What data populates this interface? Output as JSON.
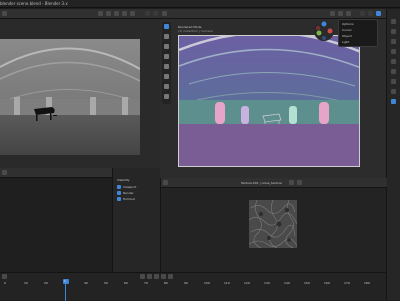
{
  "app": {
    "window_title": "blender scene.blend - Blender 3.x"
  },
  "right_viewport": {
    "overlay_title": "Rendered Mode",
    "overlay_sub": "(1) Collection | Camera",
    "popup_items": [
      "Options",
      "Cursor",
      "Object",
      "Light"
    ]
  },
  "texture_editor": {
    "header": "Texture.001 | noise_texture"
  },
  "mid_panel": {
    "header": "Visibility",
    "rows": [
      {
        "label": "Viewport"
      },
      {
        "label": "Render"
      },
      {
        "label": "Holdout"
      }
    ]
  },
  "timeline": {
    "labels": [
      "0",
      "10",
      "20",
      "30",
      "40",
      "50",
      "60",
      "70",
      "80",
      "90",
      "100",
      "110",
      "120",
      "130",
      "140",
      "150",
      "160",
      "170",
      "180"
    ],
    "current_frame": "1"
  },
  "colors": {
    "accent": "#3d86d8",
    "header": "#303030",
    "background": "#1d1d1d"
  },
  "icons": {
    "toolbar": [
      "select-icon",
      "cursor-icon",
      "move-icon",
      "rotate-icon",
      "scale-icon",
      "transform-icon",
      "annotate-icon",
      "measure-icon"
    ]
  }
}
